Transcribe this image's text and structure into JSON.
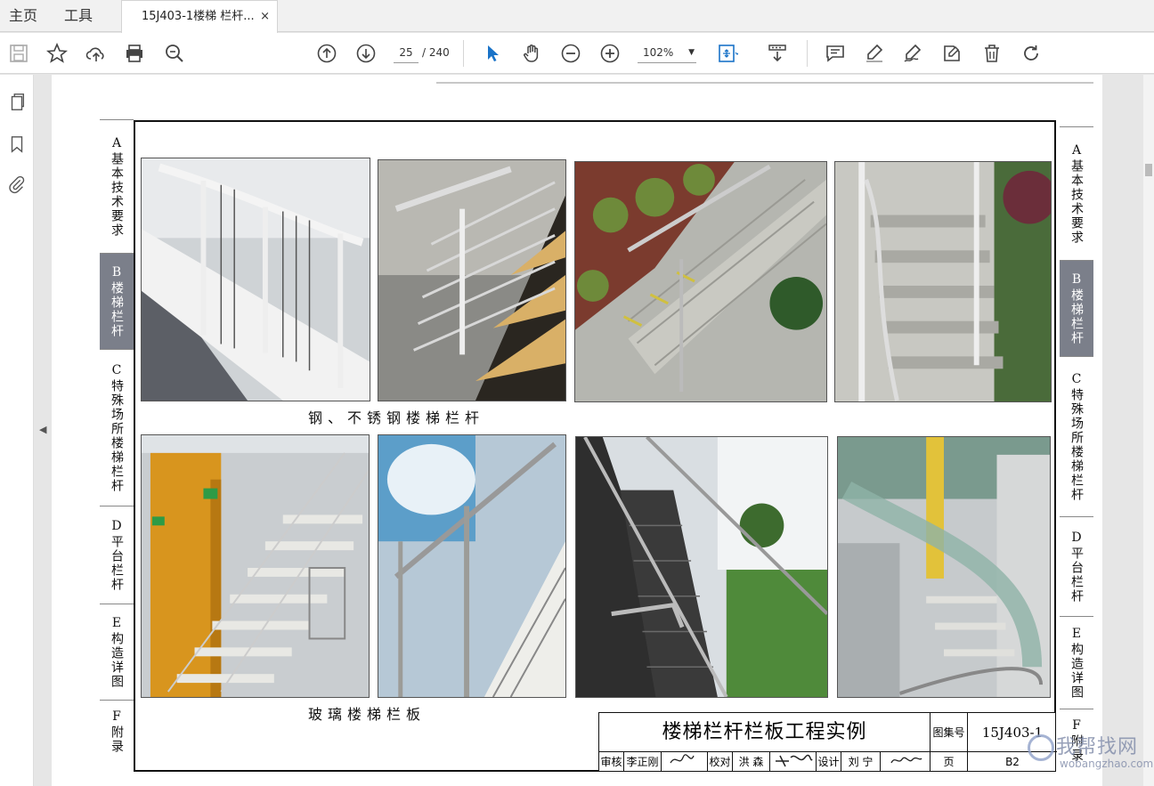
{
  "tabs": {
    "home": "主页",
    "tools": "工具",
    "document": "15J403-1楼梯 栏杆...",
    "close": "×"
  },
  "toolbar": {
    "page_current": "25",
    "page_total": "/ 240",
    "zoom": "102%",
    "icons": [
      "save-icon",
      "bookmark-star-icon",
      "cloud-upload-icon",
      "print-icon",
      "search-zoom-icon",
      "arrow-up-icon",
      "arrow-down-icon",
      "select-cursor-icon",
      "hand-icon",
      "zoom-out-icon",
      "zoom-in-icon",
      "fit-page-icon",
      "scroll-mode-icon",
      "comment-icon",
      "highlight-icon",
      "sign-icon",
      "stamp-icon",
      "delete-icon",
      "rotate-icon"
    ]
  },
  "sidebar_icons": [
    "pages-icon",
    "bookmark-icon",
    "attachment-icon"
  ],
  "left_index": [
    {
      "letter": "A",
      "text": "基本技术要求",
      "active": false
    },
    {
      "letter": "B",
      "text": "楼梯栏杆",
      "active": true
    },
    {
      "letter": "C",
      "text": "特殊场所楼梯栏杆",
      "active": false
    },
    {
      "letter": "D",
      "text": "平台栏杆",
      "active": false
    },
    {
      "letter": "E",
      "text": "构造详图",
      "active": false
    },
    {
      "letter": "F",
      "text": "附录",
      "active": false
    }
  ],
  "right_index": [
    {
      "letter": "A",
      "text": "基本技术要求",
      "active": false
    },
    {
      "letter": "B",
      "text": "楼梯栏杆",
      "active": true
    },
    {
      "letter": "C",
      "text": "特殊场所楼梯栏杆",
      "active": false
    },
    {
      "letter": "D",
      "text": "平台栏杆",
      "active": false
    },
    {
      "letter": "E",
      "text": "构造详图",
      "active": false
    },
    {
      "letter": "F",
      "text": "附录",
      "active": false
    }
  ],
  "captions": {
    "top": "钢、不锈钢楼梯栏杆",
    "bottom": "玻璃楼梯栏板"
  },
  "titleblock": {
    "title": "楼梯栏杆栏板工程实例",
    "set_label": "图集号",
    "set_code": "15J403-1",
    "review_label": "审核",
    "reviewer": "李正刚",
    "check_label": "校对",
    "checker": "洪 森",
    "design_label": "设计",
    "designer": "刘 宁",
    "page_label": "页",
    "page_code": "B2"
  },
  "watermark": {
    "main": "我帮找网",
    "sub": "wobangzhao.com"
  },
  "colors": {
    "accent_blue": "#1a73c8",
    "active_index": "#7b7f8a"
  }
}
